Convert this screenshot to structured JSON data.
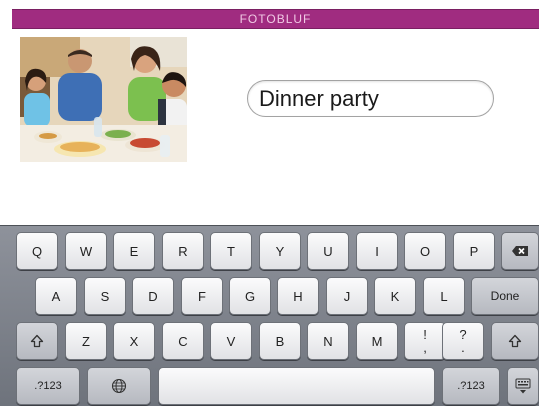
{
  "header": {
    "title": "FOTOBLUF"
  },
  "caption": {
    "value": "Dinner party"
  },
  "keyboard": {
    "row1": [
      "Q",
      "W",
      "E",
      "R",
      "T",
      "Y",
      "U",
      "I",
      "O",
      "P"
    ],
    "row2": [
      "A",
      "S",
      "D",
      "F",
      "G",
      "H",
      "J",
      "K",
      "L"
    ],
    "done_label": "Done",
    "row3": [
      "Z",
      "X",
      "C",
      "V",
      "B",
      "N",
      "M"
    ],
    "exclaim_top": "!",
    "exclaim_bottom": ",",
    "question_top": "?",
    "question_bottom": ".",
    "numbers_label": ".?123",
    "numbers_label_right": ".?123"
  },
  "icons": {
    "backspace": "backspace-icon",
    "shift": "shift-icon",
    "globe": "globe-icon",
    "hide_keyboard": "keyboard-hide-icon"
  },
  "colors": {
    "header_bg": "#a02c80",
    "header_text": "#f0c9e4"
  }
}
